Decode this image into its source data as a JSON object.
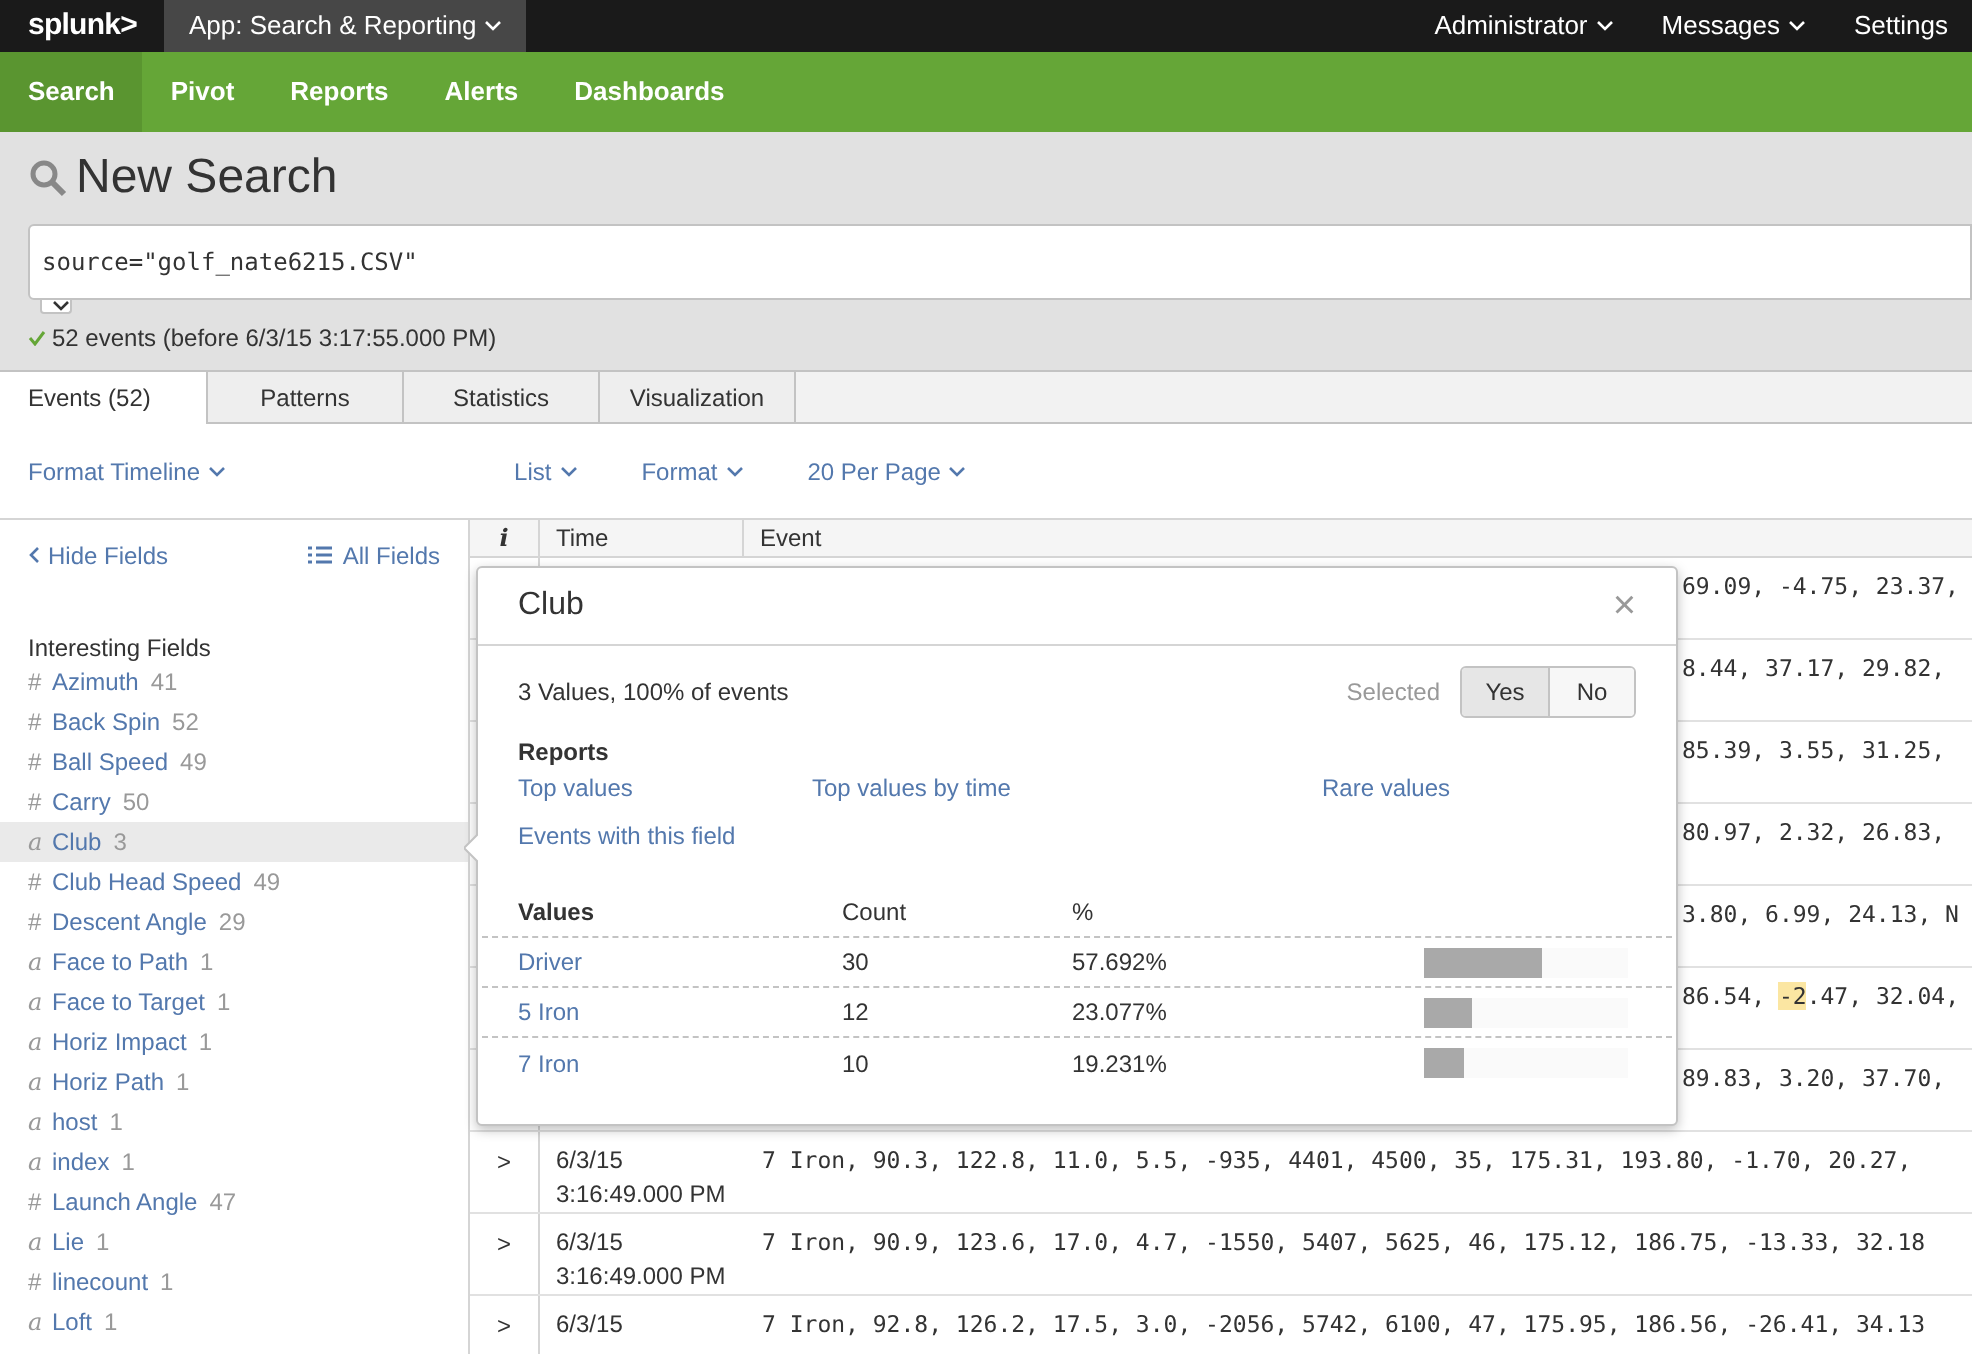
{
  "top_bar": {
    "logo": "splunk>",
    "app_menu": "App: Search & Reporting",
    "right_menus": [
      {
        "label": "Administrator",
        "dropdown": true
      },
      {
        "label": "Messages",
        "dropdown": true
      },
      {
        "label": "Settings",
        "dropdown": false
      }
    ]
  },
  "nav": [
    {
      "label": "Search",
      "selected": true
    },
    {
      "label": "Pivot",
      "selected": false
    },
    {
      "label": "Reports",
      "selected": false
    },
    {
      "label": "Alerts",
      "selected": false
    },
    {
      "label": "Dashboards",
      "selected": false
    }
  ],
  "page_title": "New Search",
  "search": {
    "value": "source=\"golf_nate6215.CSV\"",
    "status": "52 events (before 6/3/15 3:17:55.000 PM)"
  },
  "tabs": [
    {
      "label": "Events (52)",
      "selected": true
    },
    {
      "label": "Patterns",
      "selected": false
    },
    {
      "label": "Statistics",
      "selected": false
    },
    {
      "label": "Visualization",
      "selected": false
    }
  ],
  "toolbar": {
    "left": "Format Timeline",
    "menus": [
      "List",
      "Format",
      "20 Per Page"
    ]
  },
  "sidebar": {
    "hide": "Hide Fields",
    "all": "All Fields",
    "section": "Interesting Fields",
    "fields": [
      {
        "kind": "number",
        "icon": "#",
        "name": "Azimuth",
        "count": "41",
        "selected": false
      },
      {
        "kind": "number",
        "icon": "#",
        "name": "Back Spin",
        "count": "52",
        "selected": false
      },
      {
        "kind": "number",
        "icon": "#",
        "name": "Ball Speed",
        "count": "49",
        "selected": false
      },
      {
        "kind": "number",
        "icon": "#",
        "name": "Carry",
        "count": "50",
        "selected": false
      },
      {
        "kind": "string",
        "icon": "a",
        "name": "Club",
        "count": "3",
        "selected": true
      },
      {
        "kind": "number",
        "icon": "#",
        "name": "Club Head Speed",
        "count": "49",
        "selected": false
      },
      {
        "kind": "number",
        "icon": "#",
        "name": "Descent Angle",
        "count": "29",
        "selected": false
      },
      {
        "kind": "string",
        "icon": "a",
        "name": "Face to Path",
        "count": "1",
        "selected": false
      },
      {
        "kind": "string",
        "icon": "a",
        "name": "Face to Target",
        "count": "1",
        "selected": false
      },
      {
        "kind": "string",
        "icon": "a",
        "name": "Horiz Impact",
        "count": "1",
        "selected": false
      },
      {
        "kind": "string",
        "icon": "a",
        "name": "Horiz Path",
        "count": "1",
        "selected": false
      },
      {
        "kind": "string",
        "icon": "a",
        "name": "host",
        "count": "1",
        "selected": false
      },
      {
        "kind": "string",
        "icon": "a",
        "name": "index",
        "count": "1",
        "selected": false
      },
      {
        "kind": "number",
        "icon": "#",
        "name": "Launch Angle",
        "count": "47",
        "selected": false
      },
      {
        "kind": "string",
        "icon": "a",
        "name": "Lie",
        "count": "1",
        "selected": false
      },
      {
        "kind": "number",
        "icon": "#",
        "name": "linecount",
        "count": "1",
        "selected": false
      },
      {
        "kind": "string",
        "icon": "a",
        "name": "Loft",
        "count": "1",
        "selected": false
      }
    ]
  },
  "table": {
    "columns": [
      "i",
      "Time",
      "Event"
    ],
    "rows": [
      {
        "kind": "covered",
        "parts": [
          {
            "text": "69.09, -4.75, 23.37,",
            "highlighted": false
          }
        ]
      },
      {
        "kind": "covered",
        "parts": [
          {
            "text": "8.44, 37.17, 29.82,",
            "highlighted": false
          }
        ]
      },
      {
        "kind": "covered",
        "parts": [
          {
            "text": "85.39, 3.55, 31.25,",
            "highlighted": false
          }
        ]
      },
      {
        "kind": "covered",
        "parts": [
          {
            "text": "80.97, 2.32, 26.83,",
            "highlighted": false
          }
        ]
      },
      {
        "kind": "covered",
        "parts": [
          {
            "text": "3.80, 6.99, 24.13, N",
            "highlighted": false
          }
        ]
      },
      {
        "kind": "covered",
        "parts": [
          {
            "text": "86.54, ",
            "highlighted": false
          },
          {
            "text": "-2",
            "highlighted": true
          },
          {
            "text": ".47, 32.04,",
            "highlighted": false
          }
        ]
      },
      {
        "kind": "covered",
        "parts": [
          {
            "text": "89.83, 3.20, 37.70,",
            "highlighted": false
          }
        ]
      },
      {
        "kind": "full",
        "expander": ">",
        "date": "6/3/15",
        "time": "3:16:49.000 PM",
        "parts": [
          {
            "text": "7 Iron, 90.3, 122.8, 11.0, 5.5, -935, 4401, 4500, 35, 175.31, 193.80, -1.70, 20.27,",
            "highlighted": false
          }
        ]
      },
      {
        "kind": "full",
        "expander": ">",
        "date": "6/3/15",
        "time": "3:16:49.000 PM",
        "parts": [
          {
            "text": "7 Iron, 90.9, 123.6, 17.0, 4.7, -1550, 5407, 5625, 46, 175.12, 186.75, -13.33, 32.18",
            "highlighted": false
          }
        ]
      },
      {
        "kind": "full",
        "expander": ">",
        "date": "6/3/15",
        "parts": [
          {
            "text": "7 Iron, 92.8, 126.2, 17.5, 3.0, -2056, 5742, 6100, 47, 175.95, 186.56, -26.41, 34.13",
            "highlighted": false
          }
        ]
      }
    ]
  },
  "popup": {
    "title": "Club",
    "close": "×",
    "summary": "3 Values, 100% of events",
    "selected_label": "Selected",
    "toggle": [
      {
        "label": "Yes",
        "selected": true
      },
      {
        "label": "No",
        "selected": false
      }
    ],
    "reports_heading": "Reports",
    "reports": [
      "Top values",
      "Top values by time",
      "Rare values",
      "Events with this field"
    ],
    "columns": [
      "Values",
      "Count",
      "%"
    ],
    "values": [
      {
        "value": "Driver",
        "count": "30",
        "percent": "57.692%",
        "level": 0.577
      },
      {
        "value": "5 Iron",
        "count": "12",
        "percent": "23.077%",
        "level": 0.231
      },
      {
        "value": "7 Iron",
        "count": "10",
        "percent": "19.231%",
        "level": 0.192
      }
    ]
  }
}
